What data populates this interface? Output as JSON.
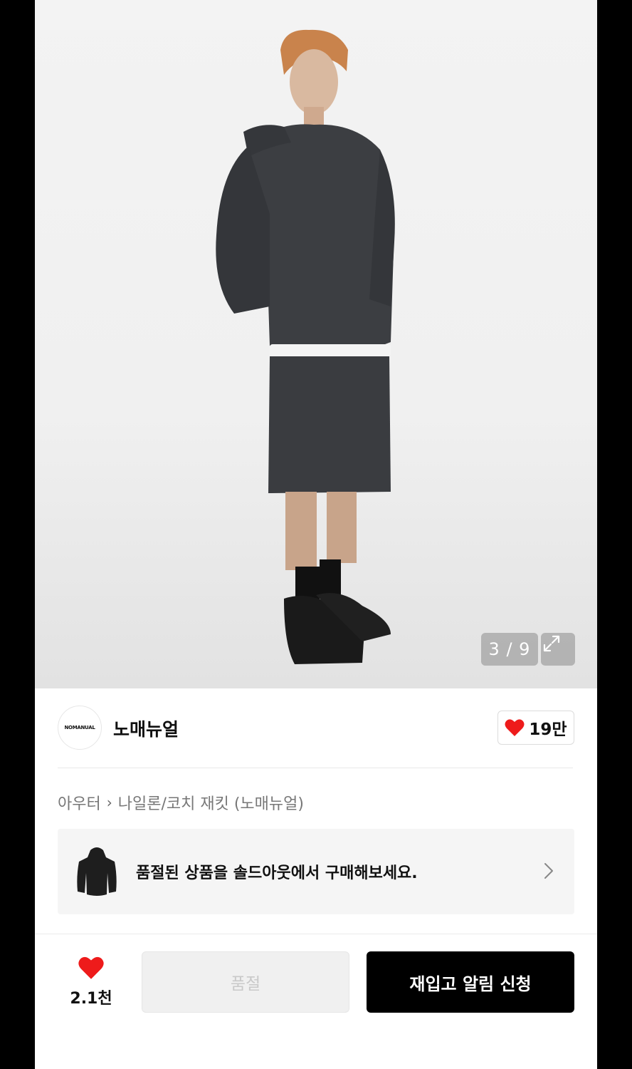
{
  "gallery": {
    "counter": "3 / 9",
    "expand_icon": "expand-icon"
  },
  "brand": {
    "logo_text": "NOMANUAL",
    "name": "노매뉴얼",
    "like_count": "19만"
  },
  "breadcrumb": {
    "category": "아우터",
    "subcategory": "나일론/코치 재킷 (노매뉴얼)"
  },
  "soldout_banner": {
    "text": "품절된 상품을 솔드아웃에서 구매해보세요."
  },
  "bottom_bar": {
    "fav_count": "2.1천",
    "soldout_label": "품절",
    "restock_label": "재입고 알림 신청"
  },
  "colors": {
    "heart": "#ee1b1b",
    "primary_button": "#000000"
  }
}
